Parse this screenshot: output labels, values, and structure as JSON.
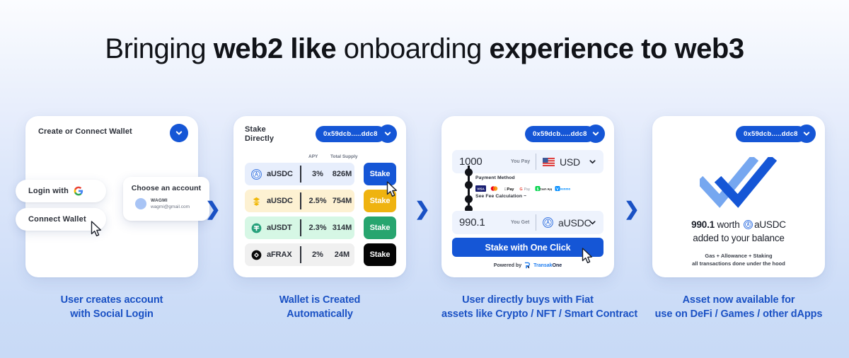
{
  "headline": {
    "part1": "Bringing ",
    "bold1": "web2 like",
    "part2": " onboarding ",
    "bold2": "experience to web3"
  },
  "colors": {
    "brand_blue": "#1556d6",
    "caption_blue": "#1a51c4",
    "gold": "#efb310",
    "green": "#27a56f",
    "black": "#050505"
  },
  "arrows": {
    "glyph": "❯"
  },
  "steps": [
    {
      "caption_line1": "User creates account",
      "caption_line2": "with Social Login",
      "card": {
        "title": "Create or Connect Wallet",
        "login_button": "Login with",
        "connect_button": "Connect Wallet",
        "chooser_title": "Choose an account",
        "account_name": "WAGMI",
        "account_email": "wagmi@gmail.com"
      }
    },
    {
      "caption_line1": "Wallet is Created",
      "caption_line2": "Automatically",
      "card": {
        "title_line1": "Stake",
        "title_line2": "Directly",
        "address": "0x59dcb.....ddc8",
        "col_apy": "APY",
        "col_supply": "Total Supply",
        "rows": [
          {
            "token": "aUSDC",
            "apy": "3%",
            "supply": "826M",
            "action": "Stake",
            "icon": "aave-icon",
            "row_bg": "#e7eefc",
            "btn_bg": "#1556d6",
            "btn_fg": "#ffffff"
          },
          {
            "token": "aUSDC",
            "apy": "2.5%",
            "supply": "754M",
            "action": "Stake",
            "icon": "binance-icon",
            "row_bg": "#fdf1d2",
            "btn_bg": "#efb310",
            "btn_fg": "#ffffff"
          },
          {
            "token": "aUSDT",
            "apy": "2.3%",
            "supply": "314M",
            "action": "Stake",
            "icon": "tether-icon",
            "row_bg": "#d6f7e5",
            "btn_bg": "#27a56f",
            "btn_fg": "#ffffff"
          },
          {
            "token": "aFRAX",
            "apy": "2%",
            "supply": "24M",
            "action": "Stake",
            "icon": "frax-icon",
            "row_bg": "#f0f0f0",
            "btn_bg": "#050505",
            "btn_fg": "#ffffff"
          }
        ]
      }
    },
    {
      "caption_line1": "User directly buys with Fiat",
      "caption_line2": "assets like Crypto / NFT / Smart Contract",
      "card": {
        "address": "0x59dcb.....ddc8",
        "pay_amount": "1000",
        "pay_label": "You Pay",
        "pay_currency": "USD",
        "get_amount": "990.1",
        "get_label": "You Get",
        "get_currency": "aUSDC",
        "payment_method_label": "Payment Method",
        "payment_methods": [
          "VISA",
          "Mastercard",
          "Apple Pay",
          "G Pay",
          "Cash App",
          "Venmo"
        ],
        "fee_label": "See Fee Calculation ~",
        "cta": "Stake with One Click",
        "powered_prefix": "Powered by",
        "powered_brand_light": "Transak",
        "powered_brand_bold": "One"
      }
    },
    {
      "caption_line1": "Asset now available for",
      "caption_line2": "use on DeFi / Games / other dApps",
      "card": {
        "address": "0x59dcb.....ddc8",
        "amount": "990.1",
        "worth_text": " worth ",
        "token": "aUSDC",
        "line2": "added to your balance",
        "footnote_line1": "Gas + Allowance + Staking",
        "footnote_line2": "all transactions done under the hood"
      }
    }
  ]
}
